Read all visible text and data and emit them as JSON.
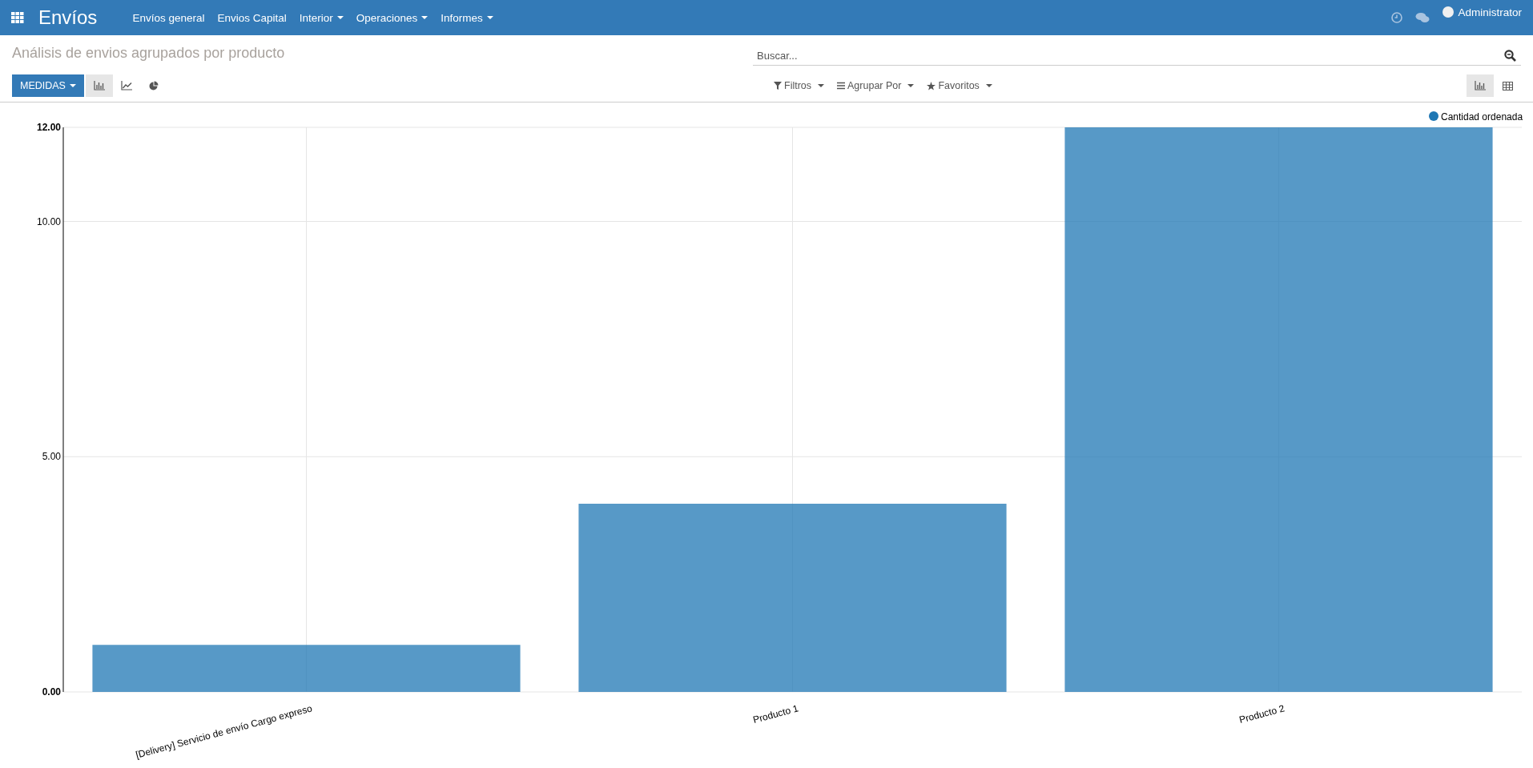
{
  "navbar": {
    "app_title": "Envíos",
    "menu": [
      {
        "label": "Envíos general",
        "dropdown": false
      },
      {
        "label": "Envios Capital",
        "dropdown": false
      },
      {
        "label": "Interior",
        "dropdown": true
      },
      {
        "label": "Operaciones",
        "dropdown": true
      },
      {
        "label": "Informes",
        "dropdown": true
      }
    ],
    "user": "Administrator"
  },
  "page_title": "Análisis de envios agrupados por producto",
  "search": {
    "placeholder": "Buscar..."
  },
  "measures_button": "MEDIDAS",
  "chart_types": [
    {
      "kind": "bar",
      "selected": true
    },
    {
      "kind": "line",
      "selected": false
    },
    {
      "kind": "pie",
      "selected": false
    }
  ],
  "filters": [
    {
      "kind": "filter",
      "label": "Filtros"
    },
    {
      "kind": "group",
      "label": "Agrupar Por"
    },
    {
      "kind": "favorite",
      "label": "Favoritos"
    }
  ],
  "views": [
    {
      "kind": "graph",
      "selected": true
    },
    {
      "kind": "pivot",
      "selected": false
    }
  ],
  "chart_data": {
    "type": "bar",
    "categories": [
      "[Delivery] Servicio de envío Cargo expreso",
      "Producto 1",
      "Producto 2"
    ],
    "series": [
      {
        "name": "Cantidad ordenada",
        "color": "#1f77b4",
        "values": [
          1,
          4,
          12
        ]
      }
    ],
    "ylim": [
      0,
      12
    ],
    "yticks": [
      {
        "value": 0,
        "label": "0.00"
      },
      {
        "value": 5,
        "label": "5.00"
      },
      {
        "value": 10,
        "label": "10.00"
      },
      {
        "value": 12,
        "label": "12.00"
      }
    ]
  }
}
